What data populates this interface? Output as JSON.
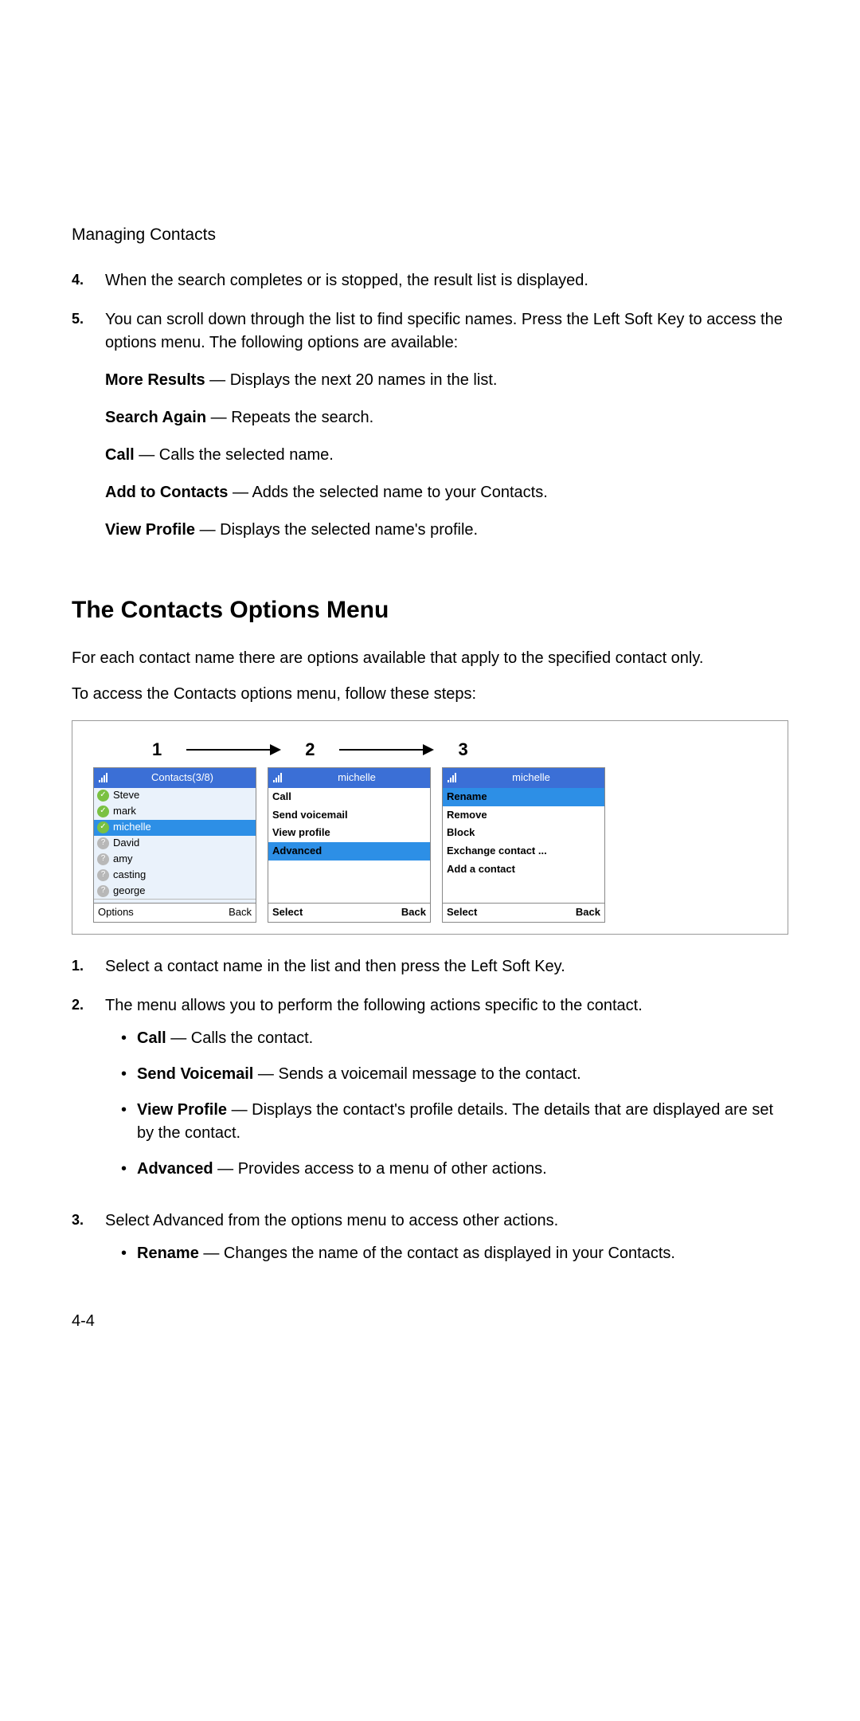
{
  "header": "Managing Contacts",
  "list1": {
    "item4": {
      "num": "4.",
      "text": "When the search completes or is stopped, the result list is displayed."
    },
    "item5": {
      "num": "5.",
      "text": "You can scroll down through the list to find specific names. Press the Left Soft Key to access the options menu. The following options are available:"
    }
  },
  "options": {
    "more": {
      "label": "More Results",
      "desc": " — Displays the next 20 names in the list."
    },
    "search": {
      "label": "Search Again",
      "desc": " — Repeats the search."
    },
    "call": {
      "label": "Call",
      "desc": " — Calls the selected name."
    },
    "add": {
      "label": "Add to Contacts",
      "desc": " — Adds the selected name to your Contacts."
    },
    "view": {
      "label": "View Profile",
      "desc": " — Displays the selected name's profile."
    }
  },
  "heading": "The Contacts Options Menu",
  "intro_para1": "For each contact name there are options available that apply to the specified contact only.",
  "intro_para2": "To access the Contacts options menu, follow these steps:",
  "steps": {
    "s1": "1",
    "s2": "2",
    "s3": "3"
  },
  "screen1": {
    "title": "Contacts(3/8)",
    "contacts": [
      "Steve",
      "mark",
      "michelle",
      "David",
      "amy",
      "casting",
      "george"
    ],
    "footer_left": "Options",
    "footer_right": "Back"
  },
  "screen2": {
    "title": "michelle",
    "menu": [
      "Call",
      "Send voicemail",
      "View profile",
      "Advanced"
    ],
    "footer_left": "Select",
    "footer_right": "Back"
  },
  "screen3": {
    "title": "michelle",
    "menu": [
      "Rename",
      "Remove",
      "Block",
      "Exchange contact ...",
      "Add a contact"
    ],
    "footer_left": "Select",
    "footer_right": "Back"
  },
  "list2": {
    "item1": {
      "num": "1.",
      "text": "Select a contact name in the list and then press the Left Soft Key."
    },
    "item2": {
      "num": "2.",
      "text": "The menu allows you to perform the following actions specific to the contact."
    },
    "item3": {
      "num": "3.",
      "text": "Select Advanced from the options menu to access other actions."
    }
  },
  "bullets2": {
    "call": {
      "label": "Call",
      "desc": " — Calls the contact."
    },
    "sv": {
      "label": "Send Voicemail",
      "desc": " — Sends a voicemail message to the contact."
    },
    "vp": {
      "label": "View Profile",
      "desc": " — Displays the contact's profile details. The details that are displayed are set by the contact."
    },
    "adv": {
      "label": "Advanced",
      "desc": " — Provides access to a menu of other actions."
    }
  },
  "bullets3": {
    "rename": {
      "label": "Rename",
      "desc": " — Changes the name of the contact as displayed in your Contacts."
    }
  },
  "page_num": "4-4"
}
